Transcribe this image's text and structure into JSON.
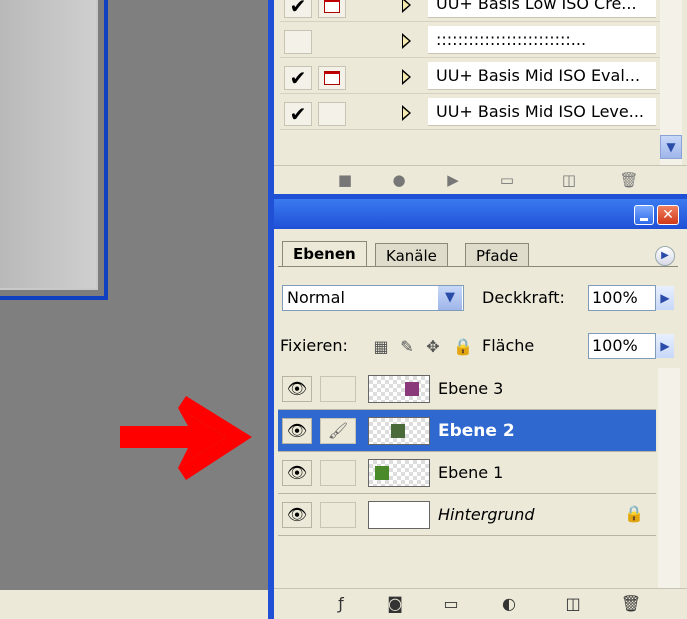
{
  "actions": {
    "rows": [
      {
        "checked": true,
        "dialog": true,
        "name": "UU+ Basis Low ISO Cre..."
      },
      {
        "checked": false,
        "dialog": false,
        "name": ":::::::::::::::::::::::::..."
      },
      {
        "checked": true,
        "dialog": true,
        "name": "UU+ Basis Mid ISO Eval..."
      },
      {
        "checked": true,
        "dialog": false,
        "name": "UU+ Basis Mid ISO Leve..."
      }
    ],
    "toolbar": [
      "stop-icon",
      "record-icon",
      "play-icon",
      "new-set-icon",
      "new-action-icon",
      "delete-icon"
    ]
  },
  "layers_panel": {
    "tabs": [
      "Ebenen",
      "Kanäle",
      "Pfade"
    ],
    "active_tab": "Ebenen",
    "blend_mode": "Normal",
    "opacity_label": "Deckkraft:",
    "opacity_value": "100%",
    "lock_label": "Fixieren:",
    "fill_label": "Fläche",
    "fill_value": "100%",
    "layers": [
      {
        "name": "Ebene 3",
        "selected": false,
        "visible": true,
        "linked_brush": false
      },
      {
        "name": "Ebene 2",
        "selected": true,
        "visible": true,
        "linked_brush": true
      },
      {
        "name": "Ebene 1",
        "selected": false,
        "visible": true,
        "linked_brush": false
      },
      {
        "name": "Hintergrund",
        "selected": false,
        "visible": true,
        "locked": true
      }
    ],
    "toolbar": [
      "layer-style-icon",
      "mask-icon",
      "group-icon",
      "adjustment-icon",
      "new-layer-icon",
      "delete-icon"
    ]
  },
  "colors": {
    "accent": "#1f50d6",
    "selection": "#2f68cf",
    "arrow": "#ff0000"
  }
}
